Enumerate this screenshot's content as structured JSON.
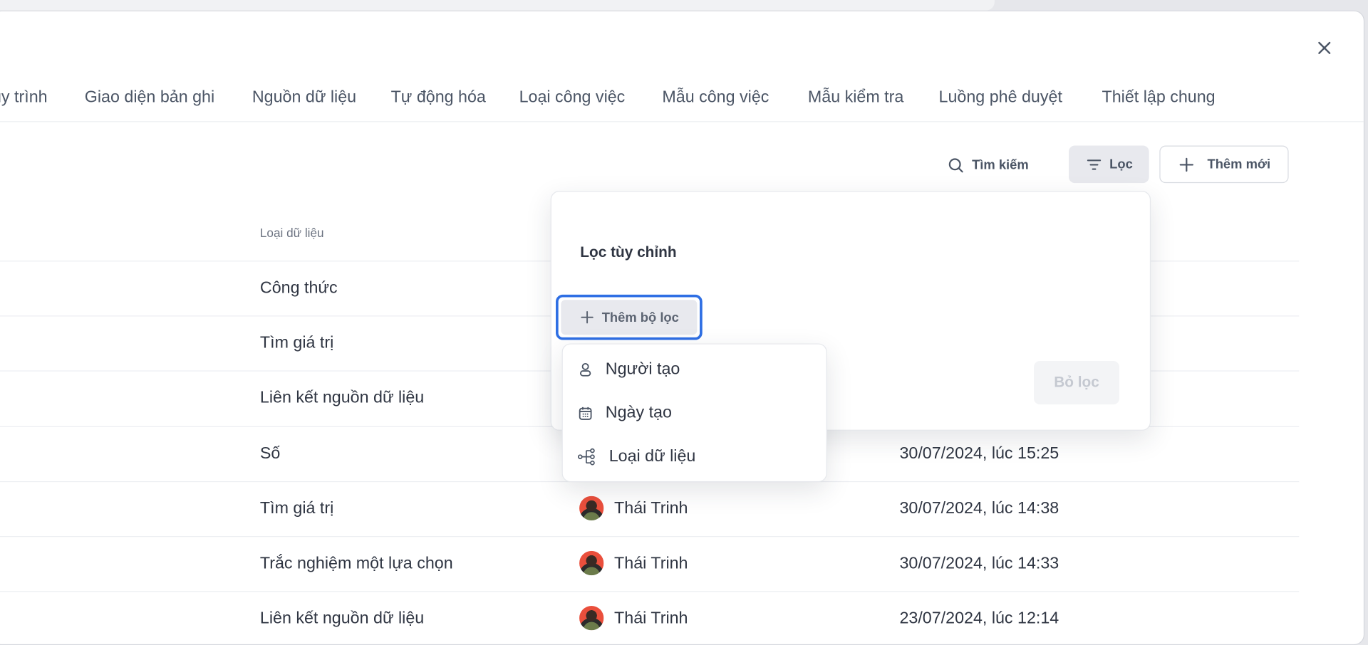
{
  "tabs": [
    "uy trình",
    "Giao diện bản ghi",
    "Nguồn dữ liệu",
    "Tự động hóa",
    "Loại công việc",
    "Mẫu công việc",
    "Mẫu kiểm tra",
    "Luồng phê duyệt",
    "Thiết lập chung"
  ],
  "toolbar": {
    "search_label": "Tìm kiếm",
    "filter_label": "Lọc",
    "add_label": "Thêm mới"
  },
  "table": {
    "column_header": "Loại dữ liệu",
    "rows": [
      {
        "type": "Công thức",
        "creator": "",
        "date": ""
      },
      {
        "type": "Tìm giá trị",
        "creator": "",
        "date": ""
      },
      {
        "type": "Liên kết nguồn dữ liệu",
        "creator": "",
        "date": ""
      },
      {
        "type": "Số",
        "creator": "",
        "date": "30/07/2024, lúc 15:25"
      },
      {
        "type": "Tìm giá trị",
        "creator": "Thái Trinh",
        "date": "30/07/2024, lúc 14:38"
      },
      {
        "type": "Trắc nghiệm một lựa chọn",
        "creator": "Thái Trinh",
        "date": "30/07/2024, lúc 14:33"
      },
      {
        "type": "Liên kết nguồn dữ liệu",
        "creator": "Thái Trinh",
        "date": "23/07/2024, lúc 12:14"
      }
    ]
  },
  "filter_popover": {
    "title": "Lọc tùy chỉnh",
    "add_filter_label": "Thêm bộ lọc",
    "clear_label": "Bỏ lọc"
  },
  "filter_menu": [
    {
      "icon": "user-icon",
      "label": "Người tạo"
    },
    {
      "icon": "calendar-icon",
      "label": "Ngày tạo"
    },
    {
      "icon": "data-type-icon",
      "label": "Loại dữ liệu"
    }
  ],
  "colors": {
    "focus_outline": "#2f6fe4",
    "avatar_bg": "#ea4f3c"
  }
}
